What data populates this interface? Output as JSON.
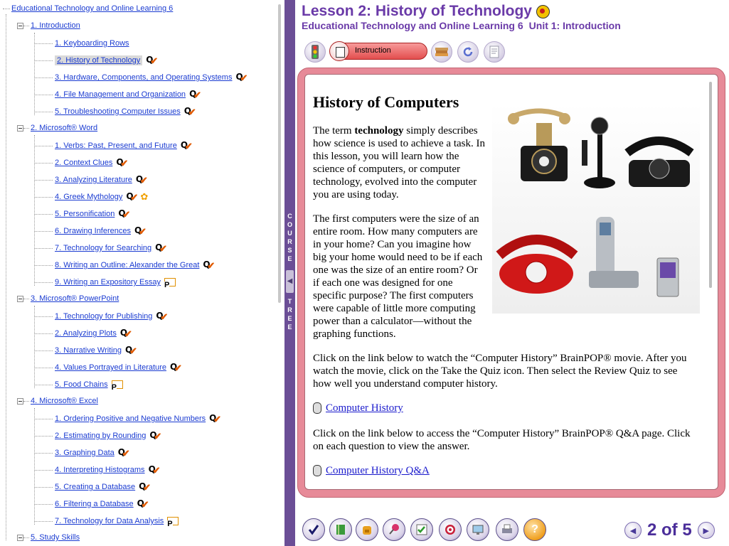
{
  "course_tree": {
    "root": "Educational Technology and Online Learning 6",
    "sections": [
      {
        "label": "1. Introduction",
        "items": [
          {
            "label": "1. Keyboarding Rows",
            "icon": "none"
          },
          {
            "label": "2. History of Technology",
            "icon": "quiz",
            "selected": true
          },
          {
            "label": "3. Hardware, Components, and Operating Systems",
            "icon": "quiz"
          },
          {
            "label": "4. File Management and Organization",
            "icon": "quiz"
          },
          {
            "label": "5. Troubleshooting Computer Issues",
            "icon": "quiz"
          }
        ]
      },
      {
        "label": "2. Microsoft® Word",
        "items": [
          {
            "label": "1. Verbs: Past, Present, and Future",
            "icon": "quiz"
          },
          {
            "label": "2. Context Clues",
            "icon": "quiz"
          },
          {
            "label": "3. Analyzing Literature",
            "icon": "quiz"
          },
          {
            "label": "4. Greek Mythology",
            "icon": "quiz-flower"
          },
          {
            "label": "5. Personification",
            "icon": "quiz"
          },
          {
            "label": "6. Drawing Inferences",
            "icon": "quiz"
          },
          {
            "label": "7. Technology for Searching",
            "icon": "quiz"
          },
          {
            "label": "8. Writing an Outline: Alexander the Great",
            "icon": "quiz"
          },
          {
            "label": "9. Writing an Expository Essay",
            "icon": "project"
          }
        ]
      },
      {
        "label": "3. Microsoft® PowerPoint",
        "items": [
          {
            "label": "1. Technology for Publishing",
            "icon": "quiz"
          },
          {
            "label": "2. Analyzing Plots",
            "icon": "quiz"
          },
          {
            "label": "3. Narrative Writing",
            "icon": "quiz"
          },
          {
            "label": "4. Values Portrayed in Literature",
            "icon": "quiz"
          },
          {
            "label": "5. Food Chains",
            "icon": "project"
          }
        ]
      },
      {
        "label": "4. Microsoft® Excel",
        "items": [
          {
            "label": "1. Ordering Positive and Negative Numbers",
            "icon": "quiz"
          },
          {
            "label": "2. Estimating by Rounding",
            "icon": "quiz"
          },
          {
            "label": "3. Graphing Data",
            "icon": "quiz"
          },
          {
            "label": "4. Interpreting Histograms",
            "icon": "quiz"
          },
          {
            "label": "5. Creating a Database",
            "icon": "quiz"
          },
          {
            "label": "6. Filtering a Database",
            "icon": "quiz"
          },
          {
            "label": "7. Technology for Data Analysis",
            "icon": "project"
          }
        ]
      },
      {
        "label": "5. Study Skills",
        "items": []
      }
    ]
  },
  "divider": {
    "label_top": "COURSE",
    "label_bottom": "TREE"
  },
  "header": {
    "title": "Lesson 2: History of Technology",
    "course": "Educational Technology and Online Learning 6",
    "unit": "Unit 1: Introduction"
  },
  "toolbar": {
    "instruction_label": "Instruction",
    "icons": [
      "traffic-light-icon",
      "instruction-icon",
      "books-icon",
      "refresh-icon",
      "notes-icon"
    ]
  },
  "content": {
    "heading": "History of Computers",
    "p1_pre": "The term ",
    "p1_bold": "technology",
    "p1_post": " simply describes how science is used to achieve a task. In this lesson, you will learn how the science of computers, or computer technology, evolved into the computer you are using today.",
    "p2": "The first computers were the size of an entire room. How many computers are in your home? Can you imagine how big your home would need to be if each one was the size of an entire room? Or if each one was designed for one specific purpose? The first computers were capable of little more computing power than a calculator—without the graphing functions.",
    "p3": "Click on the link below to watch the “Computer History” BrainPOP® movie. After you watch the movie, click on the Take the Quiz icon. Then select the Review Quiz to see how well you understand computer history.",
    "link1": "Computer History",
    "p4": "Click on the link below to access the “Computer History” BrainPOP® Q&A page. Click on each question to view the answer.",
    "link2": "Computer History Q&A"
  },
  "bottom_bar": {
    "icons": [
      "checkmark-icon",
      "book-icon",
      "backpack-icon",
      "pushpin-icon",
      "grid-check-icon",
      "target-icon",
      "monitor-icon",
      "printer-icon",
      "help-icon"
    ]
  },
  "pager": {
    "text": "2 of 5",
    "current": 2,
    "total": 5
  },
  "colors": {
    "brand_purple": "#6a3aa8",
    "frame_pink": "#e78a98",
    "link_blue": "#1a3bd1"
  }
}
